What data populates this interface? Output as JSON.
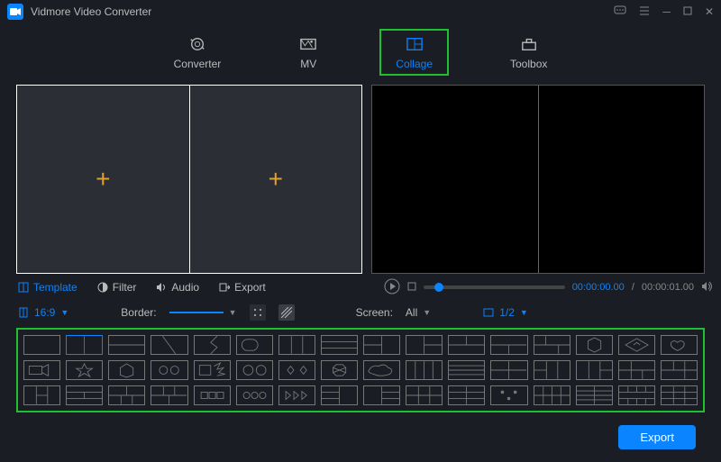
{
  "app": {
    "title": "Vidmore Video Converter"
  },
  "mainTabs": {
    "converter": "Converter",
    "mv": "MV",
    "collage": "Collage",
    "toolbox": "Toolbox"
  },
  "subTabs": {
    "template": "Template",
    "filter": "Filter",
    "audio": "Audio",
    "export": "Export"
  },
  "options": {
    "ratioLabel": "16:9",
    "borderLabel": "Border:",
    "screenLabel": "Screen:",
    "screenValue": "All",
    "pageLabel": "1/2"
  },
  "preview": {
    "timeCurrent": "00:00:00.00",
    "timeTotal": "00:00:01.00"
  },
  "footer": {
    "exportLabel": "Export"
  }
}
